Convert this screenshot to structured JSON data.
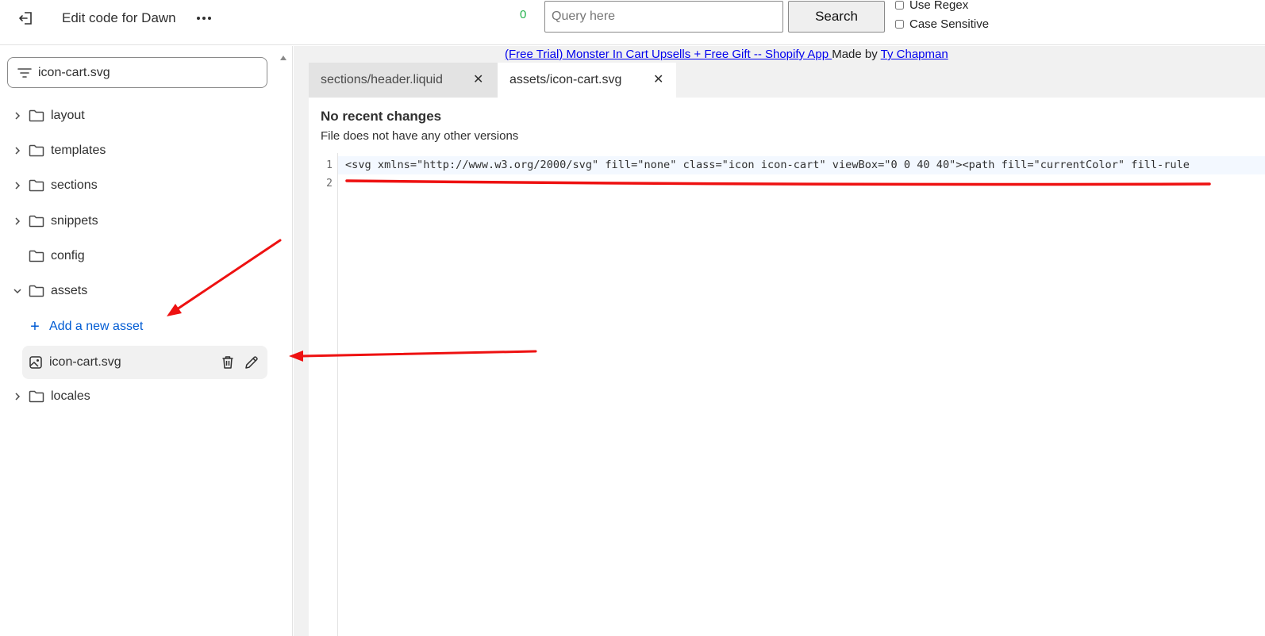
{
  "header": {
    "title": "Edit code for Dawn",
    "match_count": "0",
    "search": {
      "placeholder": "Query here",
      "value": ""
    },
    "search_button": "Search",
    "use_regex_label": "Use Regex",
    "case_sensitive_label": "Case Sensitive"
  },
  "sidebar": {
    "filter_value": "icon-cart.svg",
    "folders": [
      {
        "label": "layout",
        "expanded": false
      },
      {
        "label": "templates",
        "expanded": false
      },
      {
        "label": "sections",
        "expanded": false
      },
      {
        "label": "snippets",
        "expanded": false
      },
      {
        "label": "config",
        "expanded": false
      },
      {
        "label": "assets",
        "expanded": true
      },
      {
        "label": "locales",
        "expanded": false
      }
    ],
    "add_asset_label": "Add a new asset",
    "selected_file": "icon-cart.svg"
  },
  "promo": {
    "link_text": "(Free Trial) Monster In Cart Upsells + Free Gift -- Shopify App ",
    "made_by": "Made by ",
    "author": "Ty Chapman"
  },
  "tabs": [
    {
      "label": "sections/header.liquid",
      "active": false
    },
    {
      "prefix": "assets/",
      "filename": "icon-cart.svg",
      "active": true
    }
  ],
  "editor": {
    "version_title": "No recent changes",
    "version_subtitle": "File does not have any other versions",
    "lines": [
      {
        "number": "1",
        "text": "<svg xmlns=\"http://www.w3.org/2000/svg\" fill=\"none\" class=\"icon icon-cart\" viewBox=\"0 0 40 40\"><path fill=\"currentColor\" fill-rule"
      },
      {
        "number": "2",
        "text": ""
      }
    ]
  },
  "colors": {
    "link_blue": "#005bd3",
    "match_count_green": "#22b14c",
    "annotation_red": "#ee1111"
  }
}
